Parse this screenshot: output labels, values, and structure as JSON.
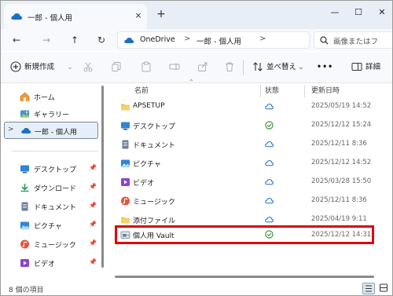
{
  "window": {
    "tab_title": "一郎 - 個人用",
    "tab_close": "×",
    "new_tab": "+",
    "minimize": "—",
    "maximize": "☐",
    "close": "✕"
  },
  "nav": {
    "back": "←",
    "forward": "→",
    "up": "↑",
    "refresh": "↻",
    "breadcrumbs": [
      "OneDrive",
      "一郎 - 個人用"
    ],
    "separator": ">",
    "search_placeholder": "画像またはフ"
  },
  "toolbar": {
    "new_label": "新規作成",
    "new_chevron": "⌄",
    "sort_label": "並べ替え",
    "sort_chevron": "⌄",
    "more_label": "•••",
    "details_label": "詳細"
  },
  "sidebar": {
    "items": [
      {
        "label": "ホーム",
        "icon": "home-icon"
      },
      {
        "label": "ギャラリー",
        "icon": "gallery-icon"
      },
      {
        "label": "一郎 - 個人用",
        "icon": "onedrive-icon",
        "selected": true,
        "chevron": ">"
      }
    ],
    "quick_access": [
      {
        "label": "デスクトップ",
        "icon": "desktop-icon",
        "pin": "📌"
      },
      {
        "label": "ダウンロード",
        "icon": "download-icon",
        "pin": "📌"
      },
      {
        "label": "ドキュメント",
        "icon": "documents-icon",
        "pin": "📌"
      },
      {
        "label": "ピクチャ",
        "icon": "pictures-icon",
        "pin": "📌"
      },
      {
        "label": "ミュージック",
        "icon": "music-icon",
        "pin": "📌"
      },
      {
        "label": "ビデオ",
        "icon": "videos-icon",
        "pin": "📌"
      }
    ]
  },
  "list": {
    "columns": {
      "name": "名前",
      "status": "状態",
      "modified": "更新日時"
    },
    "sort_caret": "⌃",
    "rows": [
      {
        "name": "APSETUP",
        "icon": "folder-icon",
        "status": "cloud",
        "date": "2025/05/19 14:52"
      },
      {
        "name": "デスクトップ",
        "icon": "desktop-icon",
        "status": "synced",
        "date": "2025/12/12 15:24"
      },
      {
        "name": "ドキュメント",
        "icon": "documents-icon",
        "status": "cloud",
        "date": "2025/12/11 8:36"
      },
      {
        "name": "ピクチャ",
        "icon": "pictures-icon",
        "status": "cloud",
        "date": "2025/12/12 14:52"
      },
      {
        "name": "ビデオ",
        "icon": "videos-icon",
        "status": "cloud",
        "date": "2025/03/28 15:50"
      },
      {
        "name": "ミュージック",
        "icon": "music-icon",
        "status": "cloud",
        "date": "2025/12/11 8:36"
      },
      {
        "name": "添付ファイル",
        "icon": "folder-icon",
        "status": "cloud",
        "date": "2025/04/19 9:11"
      },
      {
        "name": "個人用 Vault",
        "icon": "vault-icon",
        "status": "synced",
        "date": "2025/12/12 14:31",
        "highlighted": true
      }
    ]
  },
  "status": {
    "item_count": "8 個の項目"
  },
  "colors": {
    "accent": "#0f6cbd",
    "highlight_border": "#e00000",
    "synced": "#2e8b2e",
    "cloud": "#1a6fc9",
    "folder": "#f2c14b"
  }
}
